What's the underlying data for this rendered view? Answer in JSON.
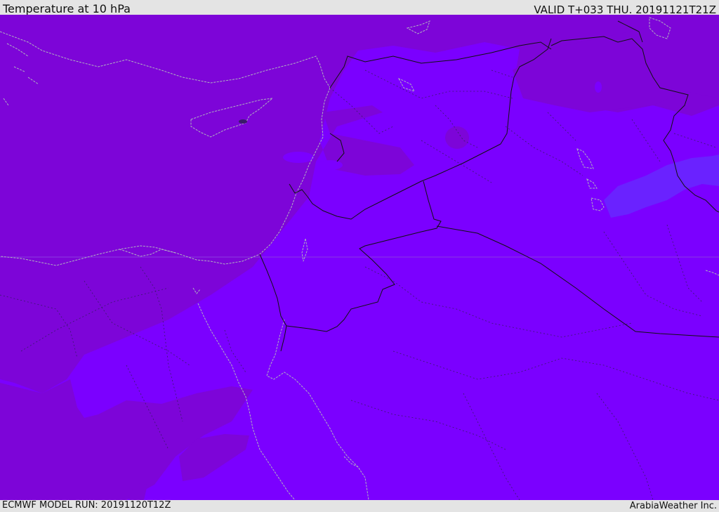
{
  "header": {
    "title": "Temperature at 10 hPa",
    "valid": "VALID T+033 THU. 20191121T21Z"
  },
  "footer": {
    "model_run": "ECMWF MODEL RUN: 20191120T12Z",
    "credit": "ArabiaWeather Inc."
  },
  "colors": {
    "field_dark": "#7d05d8",
    "field_mid": "#7c00f5",
    "field_bright": "#7b00ff",
    "field_blue": "#6a22ff",
    "border": "#111111",
    "coastline": "#b0b0c0"
  }
}
